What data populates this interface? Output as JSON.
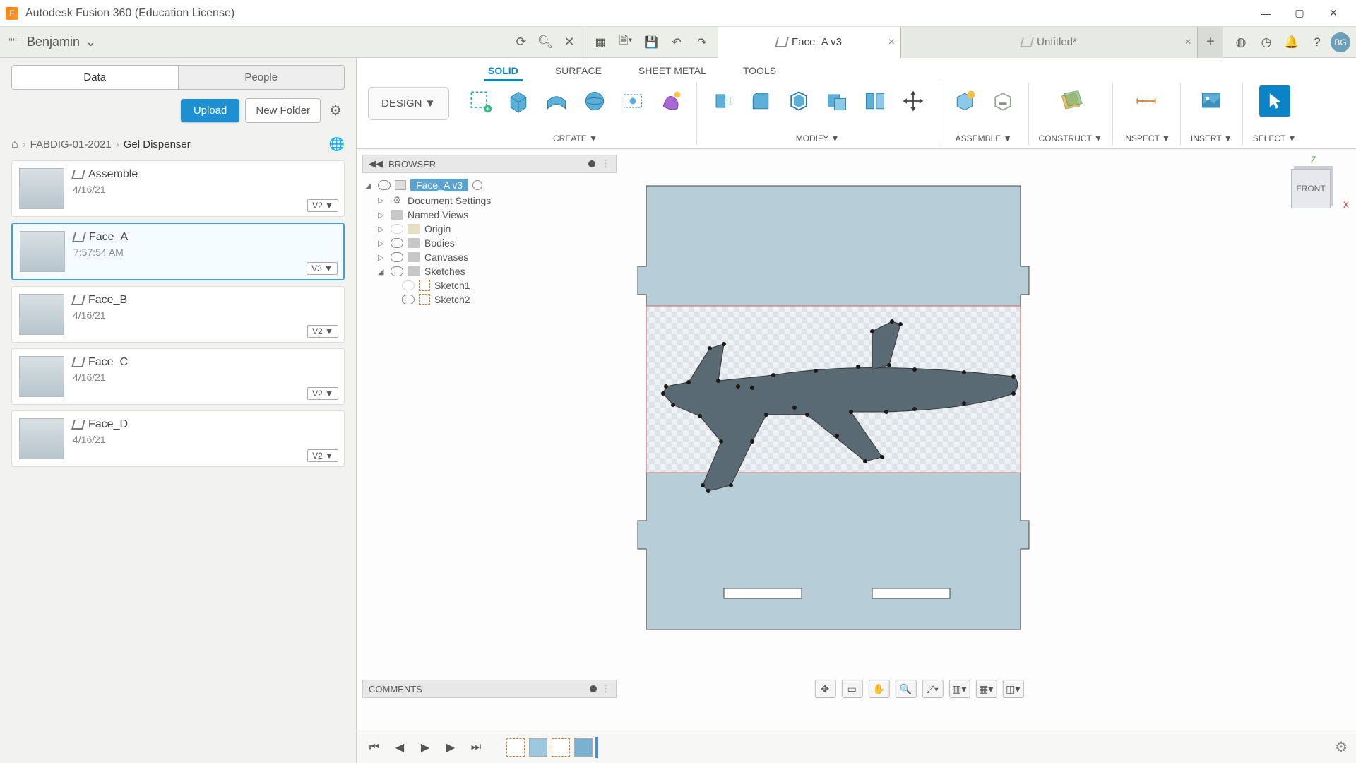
{
  "window": {
    "title": "Autodesk Fusion 360 (Education License)"
  },
  "user": {
    "name": "Benjamin",
    "initials": "BG"
  },
  "tabs": [
    {
      "label": "Face_A v3",
      "active": true
    },
    {
      "label": "Untitled*",
      "active": false
    }
  ],
  "data_panel": {
    "tab_data": "Data",
    "tab_people": "People",
    "upload": "Upload",
    "new_folder": "New Folder",
    "breadcrumb": {
      "root": "FABDIG-01-2021",
      "current": "Gel Dispenser"
    },
    "files": [
      {
        "name": "Assemble",
        "date": "4/16/21",
        "version": "V2"
      },
      {
        "name": "Face_A",
        "date": "7:57:54 AM",
        "version": "V3",
        "active": true
      },
      {
        "name": "Face_B",
        "date": "4/16/21",
        "version": "V2"
      },
      {
        "name": "Face_C",
        "date": "4/16/21",
        "version": "V2"
      },
      {
        "name": "Face_D",
        "date": "4/16/21",
        "version": "V2"
      }
    ]
  },
  "workspace": {
    "label": "DESIGN"
  },
  "ribbon": {
    "tabs": {
      "solid": "SOLID",
      "surface": "SURFACE",
      "sheet": "SHEET METAL",
      "tools": "TOOLS"
    },
    "groups": {
      "create": "CREATE",
      "modify": "MODIFY",
      "assemble": "ASSEMBLE",
      "construct": "CONSTRUCT",
      "inspect": "INSPECT",
      "insert": "INSERT",
      "select": "SELECT"
    }
  },
  "browser": {
    "title": "BROWSER",
    "root": "Face_A v3",
    "items": {
      "doc_settings": "Document Settings",
      "named_views": "Named Views",
      "origin": "Origin",
      "bodies": "Bodies",
      "canvases": "Canvases",
      "sketches": "Sketches",
      "sketch1": "Sketch1",
      "sketch2": "Sketch2"
    }
  },
  "viewcube": {
    "face": "FRONT",
    "z": "Z",
    "x": "X"
  },
  "comments": {
    "title": "COMMENTS"
  }
}
